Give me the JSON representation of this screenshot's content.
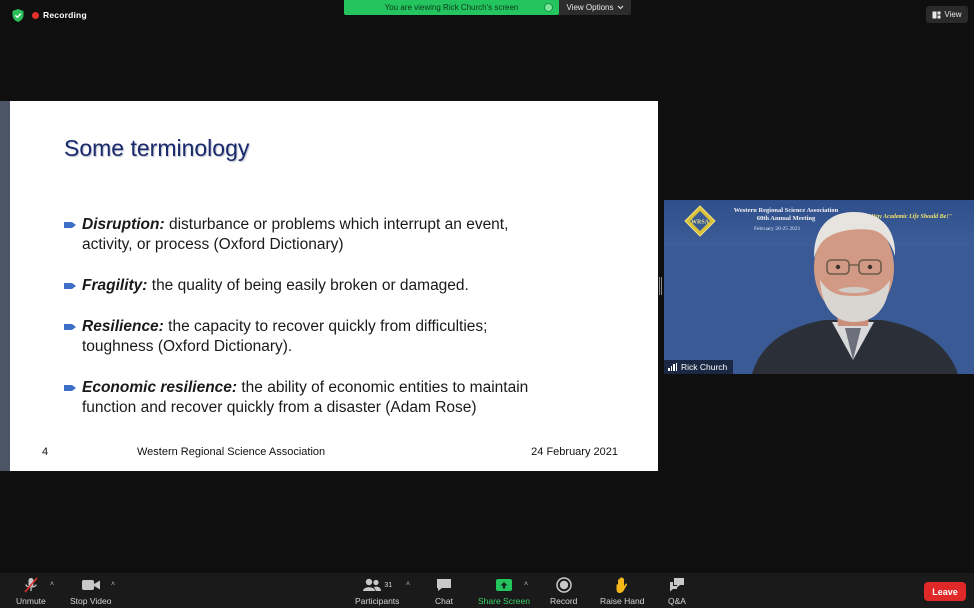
{
  "top": {
    "recording_label": "Recording",
    "banner_text": "You are viewing Rick Church's screen",
    "view_options_label": "View Options",
    "view_label": "View"
  },
  "slide": {
    "title": "Some terminology",
    "bullets": [
      {
        "term": "Disruption:",
        "text": " disturbance or problems which interrupt an event, activity, or process (Oxford Dictionary)"
      },
      {
        "term": "Fragility:",
        "text": " the quality of being easily broken or damaged."
      },
      {
        "term": "Resilience:",
        "text": " the capacity to recover quickly from difficulties; toughness (Oxford Dictionary)."
      },
      {
        "term": "Economic resilience:",
        "text": " the ability of economic entities to maintain function and recover quickly from a disaster (Adam Rose)"
      }
    ],
    "footer": {
      "page_number": "4",
      "organization": "Western Regional Science Association",
      "date": "24 February 2021"
    }
  },
  "video": {
    "participant_name": "Rick Church",
    "background": {
      "logo_text": "WRSA",
      "title_line1": "Western Regional Science Association",
      "title_line2": "60th Annual Meeting",
      "dates": "February 20-25 2021",
      "slogan": "\"Way Academic Life Should Be!\""
    }
  },
  "toolbar": {
    "unmute_label": "Unmute",
    "stop_video_label": "Stop Video",
    "participants_label": "Participants",
    "participants_count": "31",
    "chat_label": "Chat",
    "share_screen_label": "Share Screen",
    "record_label": "Record",
    "raise_hand_label": "Raise Hand",
    "qa_label": "Q&A",
    "leave_label": "Leave"
  },
  "colors": {
    "banner_green": "#24c45f",
    "slide_title_blue": "#1b2a6b",
    "bullet_arrow_blue": "#3d6fc7",
    "leave_red": "#e02828",
    "recording_red": "#e5302a"
  }
}
